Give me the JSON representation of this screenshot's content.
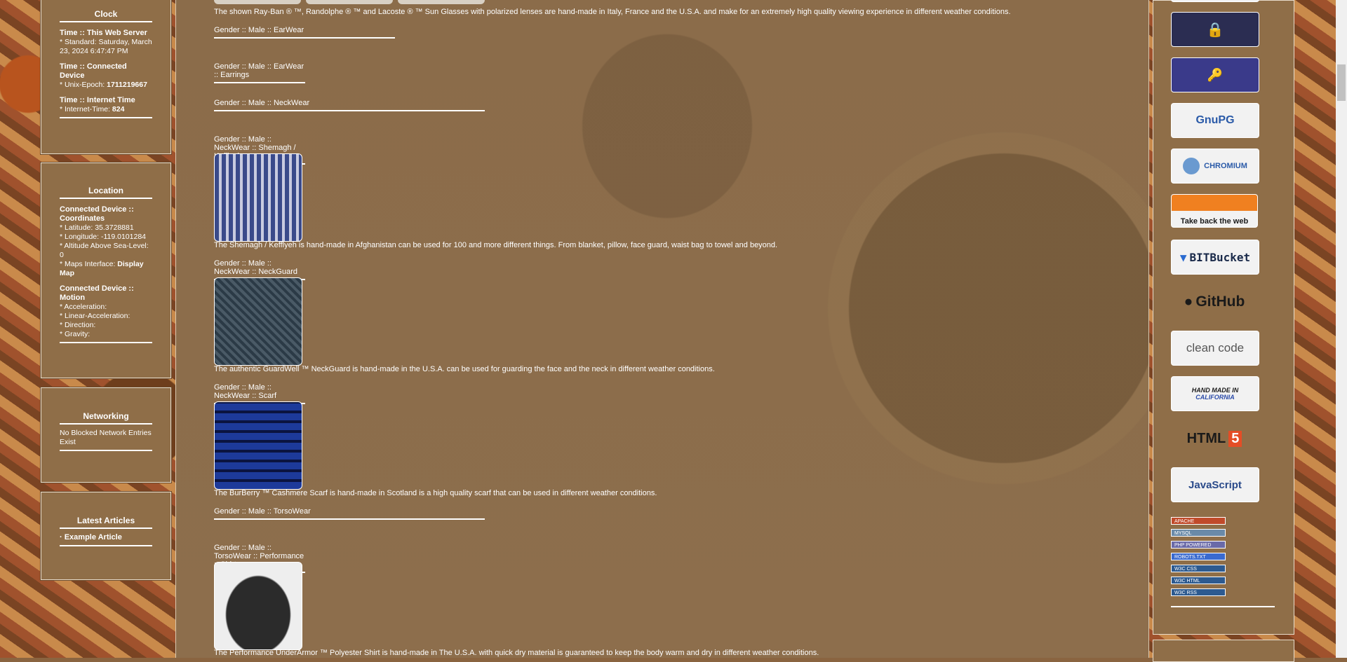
{
  "left": {
    "clock": {
      "title": "Clock",
      "server_heading": "Time :: This Web Server",
      "server_value": "* Standard: Saturday, March 23, 2024 6:47:47 PM",
      "device_heading": "Time :: Connected Device",
      "epoch_label": "* Unix-Epoch: ",
      "epoch_value": "1711219667",
      "internet_heading": "Time :: Internet Time",
      "internet_label": "* Internet-Time: ",
      "internet_value": "824"
    },
    "location": {
      "title": "Location",
      "coords_heading": "Connected Device :: Coordinates",
      "latitude": "* Latitude: 35.3728881",
      "longitude": "* Longitude: -119.0101284",
      "altitude": "* Altitude Above Sea-Level: 0",
      "maps_label": "* Maps Interface: ",
      "maps_link": "Display Map",
      "motion_heading": "Connected Device :: Motion",
      "acceleration": "* Acceleration:",
      "linear_acceleration": "* Linear-Acceleration:",
      "direction": "* Direction:",
      "gravity": "* Gravity:"
    },
    "networking": {
      "title": "Networking",
      "text": "No Blocked Network Entries Exist"
    },
    "articles": {
      "title": "Latest Articles",
      "item": "· Example Article"
    }
  },
  "main": {
    "top_desc": "The shown Ray-Ban ® ™, Randolphe ® ™ and Lacoste ® ™ Sun Glasses with polarized lenses are hand-made in Italy, France and the U.S.A. and make for an extremely high quality viewing experience in different weather conditions.",
    "sections": [
      {
        "label": "Gender :: Male :: EarWear"
      },
      {
        "label": "Gender :: Male :: EarWear :: Earrings"
      },
      {
        "label": "Gender :: Male :: NeckWear"
      },
      {
        "label": "Gender :: Male :: NeckWear :: Shemagh / Kefflyeh"
      },
      {
        "label": "Gender :: Male :: NeckWear :: NeckGuard"
      },
      {
        "label": "Gender :: Male :: NeckWear :: Scarf"
      },
      {
        "label": "Gender :: Male :: TorsoWear"
      },
      {
        "label": "Gender :: Male :: TorsoWear :: Performance :: Shirt"
      }
    ],
    "descs": {
      "shemagh": "The Shemagh / Kefflyeh is hand-made in Afghanistan can be used for 100 and more different things. From blanket, pillow, face guard, waist bag to towel and beyond.",
      "neckguard": "The authentic GuardWell ™ NeckGuard is hand-made in the U.S.A. can be used for guarding the face and the neck in different weather conditions.",
      "scarf": "The BurBerry ™ Cashmere Scarf is hand-made in Scotland is a high quality scarf that can be used in different weather conditions.",
      "shirt": "The Performance UnderArmor ™ Polyester Shirt is hand-made in The U.S.A. with quick dry material is guaranteed to keep the body warm and dry in different weather conditions."
    }
  },
  "right": {
    "badges": {
      "gnupg": "GnuPG",
      "chromium": "CHROMIUM",
      "takeback": "Take back the web",
      "bitbucket": "BITBucket",
      "github": "GitHub",
      "cleancode": "clean code",
      "handmade_line1": "HAND MADE IN",
      "handmade_line2": "CALIFORNIA",
      "html5": "HTML",
      "javascript": "JavaScript"
    },
    "mini": [
      "APACHE",
      "MYSQL",
      "PHP POWERED",
      "ROBOTS.TXT",
      "W3C CSS",
      "W3C HTML",
      "W3C RSS"
    ]
  }
}
